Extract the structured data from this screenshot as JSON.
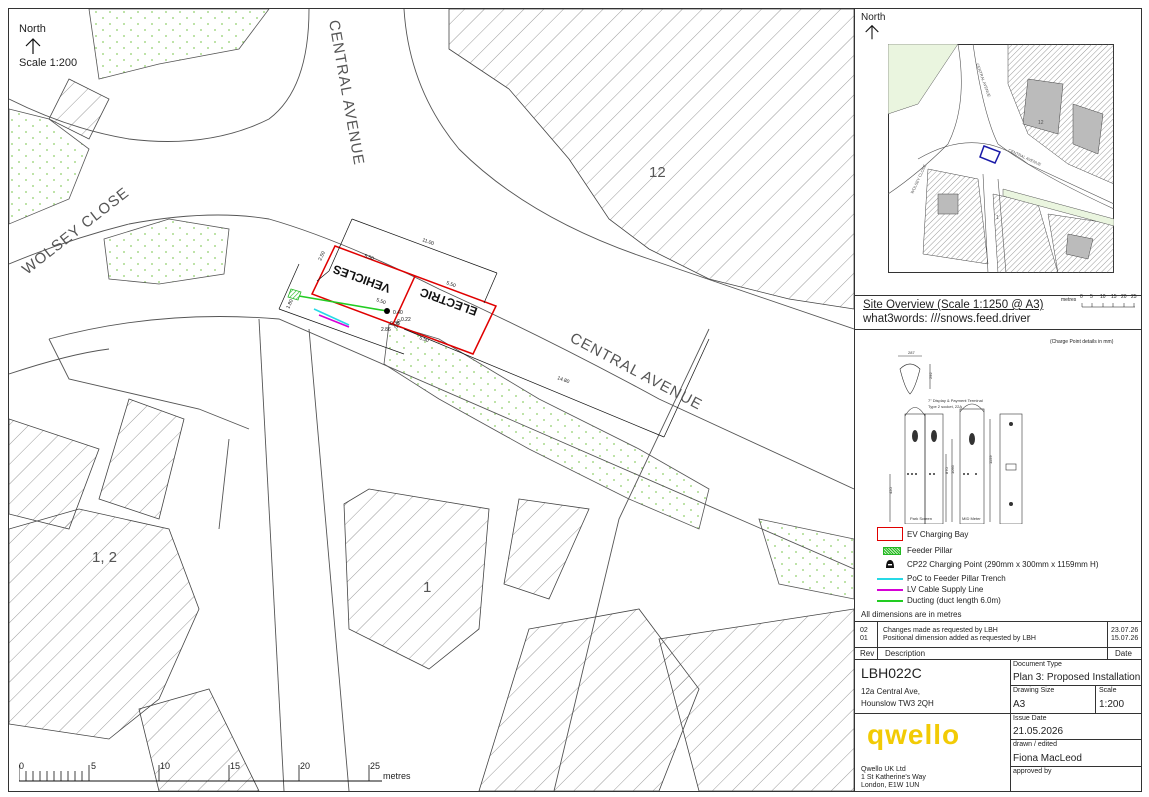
{
  "map": {
    "north_label": "North",
    "scale_label": "Scale 1:200",
    "street_central_vertical": "CENTRAL AVENUE",
    "street_central_diag": "CENTRAL AVENUE",
    "street_wolsey": "WOLSEY CLOSE",
    "house_12": "12",
    "house_1_2": "1, 2",
    "house_1": "1",
    "bay_vehicles": "VEHICLES",
    "bay_electric": "ELECTRIC",
    "dims": {
      "d1": "11.00",
      "d2": "5.50",
      "d3": "5.50",
      "d4": "5.50",
      "d5": "5.50",
      "d6": "2.50",
      "d7": "1.80",
      "d8": "14.80",
      "d9": "0.90",
      "d10": "2.86",
      "d11": "0.40",
      "d12": "0.22",
      "d13": "0.35"
    },
    "scalebar": {
      "ticks": [
        "0",
        "5",
        "10",
        "15",
        "20",
        "25"
      ],
      "unit": "metres"
    }
  },
  "overview": {
    "north_label": "North",
    "title": "Site Overview (Scale 1:1250 @ A3)",
    "what3words": "what3words: ///snows.feed.driver",
    "mini_scale": {
      "unit": "metres",
      "ticks": [
        "0",
        "5",
        "10",
        "15",
        "20",
        "25"
      ]
    },
    "labels": {
      "central_v": "CENTRAL AVENUE",
      "central_d": "CENTRAL AVENUE",
      "wolsey": "WOLSEY CLOSE",
      "h12": "12",
      "h1": "1"
    }
  },
  "detail": {
    "note": "(Charge Point details in mm)",
    "dims": {
      "w": "287",
      "d": "292",
      "h1": "1159",
      "h2": "1095",
      "h3": "870",
      "h4": "420"
    },
    "callouts": [
      "7\" Display & Payment Terminal",
      "Type 2 socket, 22A"
    ],
    "base_labels": [
      "Park Screen",
      "MID Meter"
    ]
  },
  "legend": [
    {
      "label": "EV Charging Bay",
      "color": "#e00000"
    },
    {
      "label": "Feeder Pillar",
      "color": "#22b822"
    },
    {
      "label": "CP22 Charging Point (290mm x 300mm x 1159mm H)",
      "color": "#000000"
    },
    {
      "label": "PoC to Feeder Pillar Trench",
      "color": "#26d9e6"
    },
    {
      "label": "LV Cable Supply Line",
      "color": "#d600d6"
    },
    {
      "label": "Ducting (duct length 6.0m)",
      "color": "#22cc22"
    }
  ],
  "dimensions_note": "All dimensions are  in metres",
  "revisions": {
    "rows": [
      {
        "rev": "02",
        "desc": "Changes made as requested by LBH",
        "date": "23.07.26"
      },
      {
        "rev": "01",
        "desc": "Positional dimension added as requested by LBH",
        "date": "15.07.26"
      }
    ],
    "headers": {
      "rev": "Rev",
      "desc": "Description",
      "date": "Date"
    }
  },
  "titleblock": {
    "ref": "LBH022C",
    "address1": "12a Central Ave,",
    "address2": "Hounslow TW3 2QH",
    "doc_type_label": "Document Type",
    "doc_type": "Plan 3: Proposed Installation",
    "drawing_size_label": "Drawing Size",
    "drawing_size": "A3",
    "scale_label": "Scale",
    "scale": "1:200",
    "issue_date_label": "Issue Date",
    "issue_date": "21.05.2026",
    "drawn_label": "drawn / edited",
    "drawn": "Fiona MacLeod",
    "approved_label": "approved by",
    "logo": "qwello",
    "company": "Qwello UK Ltd",
    "company_addr1": "1 St Katherine's Way",
    "company_addr2": "London, E1W 1UN"
  },
  "colors": {
    "brand_yellow": "#f2cb05",
    "bay_red": "#e00000",
    "verge_green": "#8fcf6a"
  }
}
